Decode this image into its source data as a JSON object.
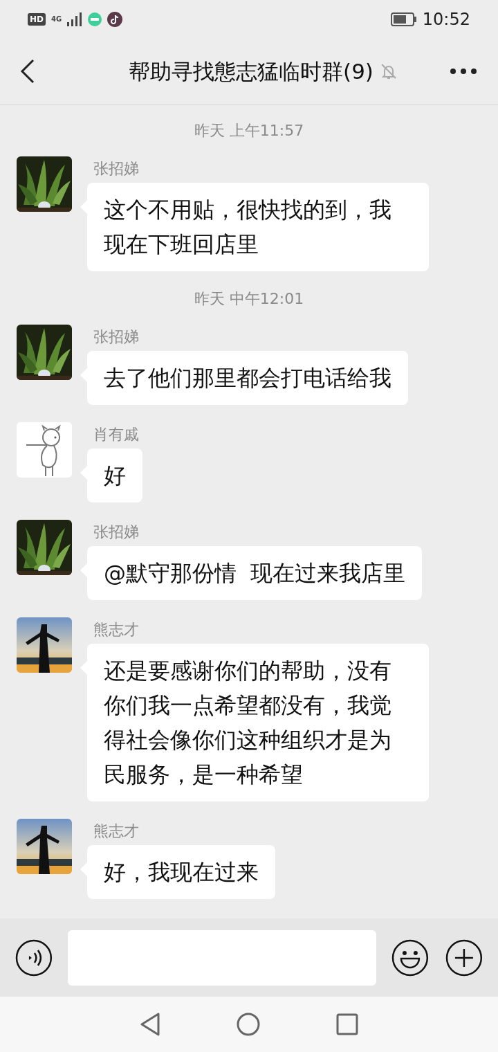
{
  "status_bar": {
    "network_badge": "HD",
    "network_type": "4G",
    "time": "10:52"
  },
  "header": {
    "title": "帮助寻找態志猛临时群(9)",
    "muted": true
  },
  "messages": [
    {
      "kind": "time",
      "text": "昨天 上午11:57"
    },
    {
      "kind": "message",
      "sender": "张招娣",
      "avatar": {
        "kind": "plant"
      },
      "text": "这个不用贴，很快找的到，我现在下班回店里"
    },
    {
      "kind": "time",
      "text": "昨天 中午12:01"
    },
    {
      "kind": "message",
      "sender": "张招娣",
      "avatar": {
        "kind": "plant"
      },
      "text": "去了他们那里都会打电话给我"
    },
    {
      "kind": "message",
      "sender": "肖有戚",
      "avatar": {
        "kind": "drawing"
      },
      "text": "好"
    },
    {
      "kind": "message",
      "sender": "张招娣",
      "avatar": {
        "kind": "plant"
      },
      "text": "@默守那份情  现在过来我店里"
    },
    {
      "kind": "message",
      "sender": "熊志才",
      "avatar": {
        "kind": "silhouette"
      },
      "text": "还是要感谢你们的帮助，没有你们我一点希望都没有，我觉得社会像你们这种组织才是为民服务，是一种希望"
    },
    {
      "kind": "message",
      "sender": "熊志才",
      "avatar": {
        "kind": "silhouette"
      },
      "text": "好，我现在过来"
    }
  ]
}
